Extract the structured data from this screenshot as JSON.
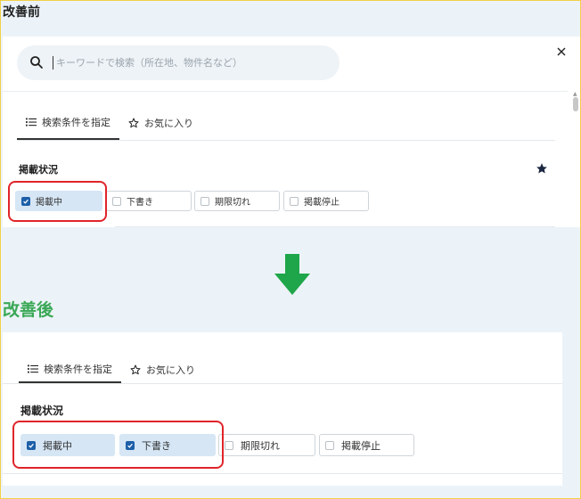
{
  "before": {
    "section_title": "改善前",
    "search": {
      "placeholder": "キーワードで検索（所在地、物件名など）",
      "value": ""
    },
    "tabs": [
      {
        "label": "検索条件を指定",
        "icon": "list-icon",
        "active": true
      },
      {
        "label": "お気に入り",
        "icon": "star-outline-icon",
        "active": false
      }
    ],
    "group_label": "掲載状況",
    "favorite_icon": "star-filled-icon",
    "options": [
      {
        "label": "掲載中",
        "checked": true
      },
      {
        "label": "下書き",
        "checked": false
      },
      {
        "label": "期限切れ",
        "checked": false
      },
      {
        "label": "掲載停止",
        "checked": false
      }
    ]
  },
  "arrow_icon": "arrow-down-icon",
  "after": {
    "section_title": "改善後",
    "tabs": [
      {
        "label": "検索条件を指定",
        "icon": "list-icon",
        "active": true
      },
      {
        "label": "お気に入り",
        "icon": "star-outline-icon",
        "active": false
      }
    ],
    "group_label": "掲載状況",
    "options": [
      {
        "label": "掲載中",
        "checked": true
      },
      {
        "label": "下書き",
        "checked": true
      },
      {
        "label": "期限切れ",
        "checked": false
      },
      {
        "label": "掲載停止",
        "checked": false
      }
    ]
  },
  "colors": {
    "page_background": "#ecf3f8",
    "checked_chip": "#d6e6f5",
    "checkbox_checked": "#1d5fa8",
    "highlight": "#e0242a",
    "arrow": "#1fa64a",
    "after_title": "#3aa856"
  }
}
